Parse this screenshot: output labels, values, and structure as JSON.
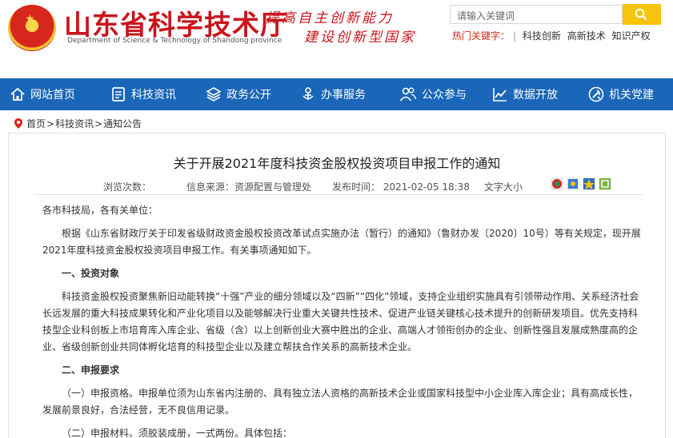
{
  "header": {
    "title": "山东省科学技术厅",
    "subtitle": "Department of Science & Technology of Shandong province",
    "slogan_line1": "提高自主创新能力",
    "slogan_line2": "建设创新型国家",
    "search": {
      "placeholder": "请输入关键词"
    },
    "hot_keywords": {
      "label": "热门关键字：",
      "items": [
        "科技创新",
        "高新技术",
        "知识产权"
      ]
    }
  },
  "nav": {
    "items": [
      {
        "label": "网站首页",
        "icon": "home-icon"
      },
      {
        "label": "科技资讯",
        "icon": "news-icon"
      },
      {
        "label": "政务公开",
        "icon": "layers-icon"
      },
      {
        "label": "办事服务",
        "icon": "service-icon"
      },
      {
        "label": "公众参与",
        "icon": "people-icon"
      },
      {
        "label": "数据开放",
        "icon": "chart-icon"
      },
      {
        "label": "机关党建",
        "icon": "party-icon"
      }
    ]
  },
  "breadcrumb": [
    "首页",
    "科技资讯",
    "通知公告"
  ],
  "article": {
    "title": "关于开展2021年度科技资金股权投资项目申报工作的通知",
    "views_label": "浏览次数：",
    "source": "信息来源：资源配置与管理处",
    "published": "发布时间： 2021-02-05 18:38",
    "font_size_label": "文字大小",
    "greeting": "各市科技局，各有关单位：",
    "intro": "根据《山东省财政厅关于印发省级财政资金股权投资改革试点实施办法（暂行）的通知》（鲁财办发〔2020〕10号）等有关规定，现开展2021年度科技资金股权投资项目申报工作。有关事项通知如下。",
    "section1_heading": "一、投资对象",
    "section1_text": "科技资金股权投资聚焦新旧动能转换“十强”产业的细分领域以及“四新”“四化”领域，支持企业组织实施具有引领带动作用、关系经济社会长远发展的重大科技成果转化和产业化项目以及能够解决行业重大关键共性技术、促进产业链关键核心技术提升的创新研发项目。优先支持科技型企业科创板上市培育库入库企业、省级（含）以上创新创业大赛中胜出的企业、高端人才领衔创办的企业、创新性强且发展成熟度高的企业、省级创新创业共同体孵化培育的科技型企业以及建立帮扶合作关系的高新技术企业。",
    "section2_heading": "二、申报要求",
    "section2_item1": "（一）申报资格。申报单位须为山东省内注册的、具有独立法人资格的高新技术企业或国家科技型中小企业库入库企业；具有高成长性，发展前景良好，合法经营，无不良信用记录。",
    "section2_item2": "（二）申报材料。须胶装成册，一式两份。具体包括："
  },
  "colors": {
    "brand_red": "#c8161d",
    "nav_blue": "#1a66b8",
    "search_yellow": "#f6c40e"
  }
}
